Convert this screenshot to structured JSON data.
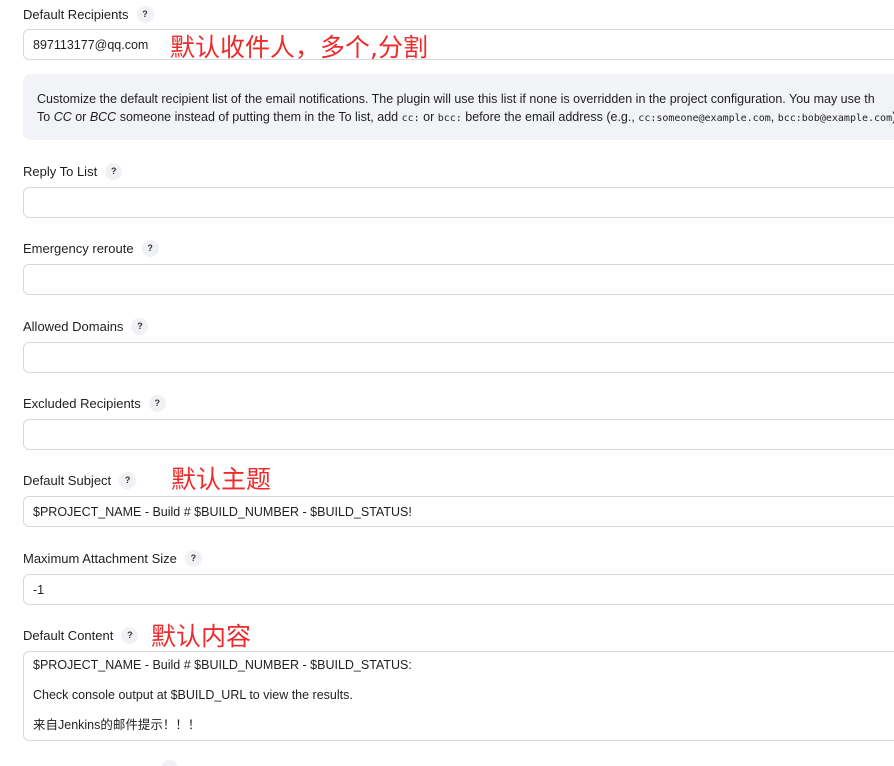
{
  "fields": {
    "default_recipients": {
      "label": "Default Recipients",
      "value": "897113177@qq.com",
      "annotation": "默认收件人，多个,分割"
    },
    "help_text": {
      "line1": "Customize the default recipient list of the email notifications. The plugin will use this list if none is overridden in the project configuration. You may use th",
      "line2_a": "To ",
      "cc": "CC",
      "line2_b": " or ",
      "bcc": "BCC",
      "line2_c": " someone instead of putting them in the To list, add ",
      "code_cc": "cc:",
      "line2_d": " or ",
      "code_bcc": "bcc:",
      "line2_e": " before the email address (e.g., ",
      "code_ex1": "cc:someone@example.com",
      "line2_f": ", ",
      "code_ex2": "bcc:bob@example.com",
      "line2_g": ")."
    },
    "reply_to_list": {
      "label": "Reply To List",
      "value": ""
    },
    "emergency_reroute": {
      "label": "Emergency reroute",
      "value": ""
    },
    "allowed_domains": {
      "label": "Allowed Domains",
      "value": ""
    },
    "excluded_recipients": {
      "label": "Excluded Recipients",
      "value": ""
    },
    "default_subject": {
      "label": "Default Subject",
      "value": "$PROJECT_NAME - Build # $BUILD_NUMBER - $BUILD_STATUS!",
      "annotation": "默认主题"
    },
    "max_attachment_size": {
      "label": "Maximum Attachment Size",
      "value": "-1"
    },
    "default_content": {
      "label": "Default Content",
      "annotation": "默认内容",
      "lines": [
        "$PROJECT_NAME - Build # $BUILD_NUMBER - $BUILD_STATUS:",
        "Check console output at $BUILD_URL to view the results.",
        "来自Jenkins的邮件提示！！！"
      ]
    }
  },
  "help_icon": {
    "glyph": "?",
    "icon": "question-icon"
  },
  "colors": {
    "annotation": "#ee2b2b",
    "help_bg": "#f2f3f6",
    "border": "#d7d8de"
  }
}
